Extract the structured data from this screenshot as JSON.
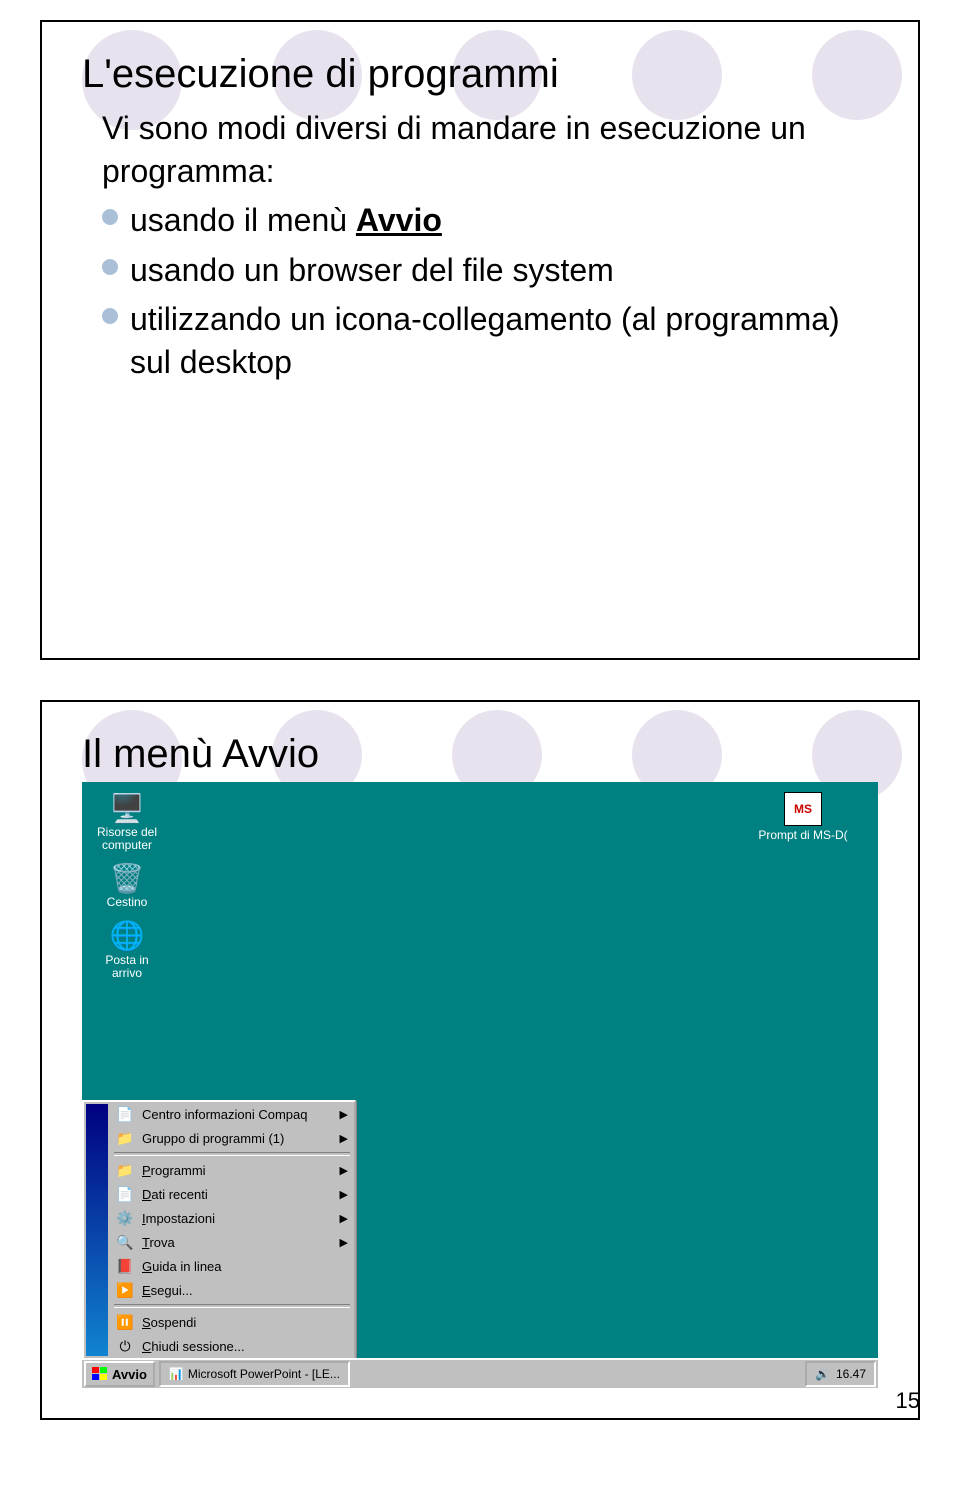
{
  "pageNumber": "15",
  "slide1": {
    "title": "L'esecuzione di programmi",
    "intro": "Vi sono modi diversi di mandare in esecuzione un programma:",
    "bullets": [
      {
        "pre": "usando il menù ",
        "emph": "Avvio",
        "post": ""
      },
      {
        "pre": "usando un browser del file system",
        "emph": "",
        "post": ""
      },
      {
        "pre": "utilizzando  un icona-collegamento (al programma) sul desktop",
        "emph": "",
        "post": ""
      }
    ]
  },
  "slide2": {
    "title": "Il menù Avvio",
    "desktop": {
      "iconsLeft": [
        {
          "name": "risorse",
          "label": "Risorse del computer",
          "glyph": "🖥️"
        },
        {
          "name": "cestino",
          "label": "Cestino",
          "glyph": "🗑️"
        },
        {
          "name": "posta",
          "label": "Posta in arrivo",
          "glyph": "🌐"
        }
      ],
      "iconRight": {
        "name": "msdos",
        "label": "Prompt di MS-D(",
        "glyph": "MS"
      },
      "menu": [
        {
          "name": "compaq",
          "label": "Centro informazioni Compaq",
          "icon": "📄",
          "arrow": true
        },
        {
          "name": "gruppo",
          "label": "Gruppo di programmi (1)",
          "icon": "📁",
          "arrow": true
        },
        {
          "sep": true
        },
        {
          "name": "programmi",
          "mnemonic": "P",
          "rest": "rogrammi",
          "icon": "📁",
          "arrow": true
        },
        {
          "name": "dati",
          "mnemonic": "D",
          "rest": "ati recenti",
          "icon": "📄",
          "arrow": true
        },
        {
          "name": "impostazioni",
          "mnemonic": "I",
          "rest": "mpostazioni",
          "icon": "⚙️",
          "arrow": true
        },
        {
          "name": "trova",
          "mnemonic": "T",
          "rest": "rova",
          "icon": "🔍",
          "arrow": true
        },
        {
          "name": "guida",
          "mnemonic": "G",
          "rest": "uida in linea",
          "icon": "📕",
          "arrow": false
        },
        {
          "name": "esegui",
          "mnemonic": "E",
          "rest": "segui...",
          "icon": "▶️",
          "arrow": false
        },
        {
          "sep": true
        },
        {
          "name": "sospendi",
          "mnemonic": "S",
          "rest": "ospendi",
          "icon": "⏸️",
          "arrow": false
        },
        {
          "name": "chiudi",
          "mnemonic": "C",
          "rest": "hiudi sessione...",
          "icon": "⏻",
          "arrow": false
        }
      ],
      "startLabel": "Avvio",
      "taskbtnLabel": "Microsoft PowerPoint - [LE...",
      "clock": "16.47"
    }
  }
}
